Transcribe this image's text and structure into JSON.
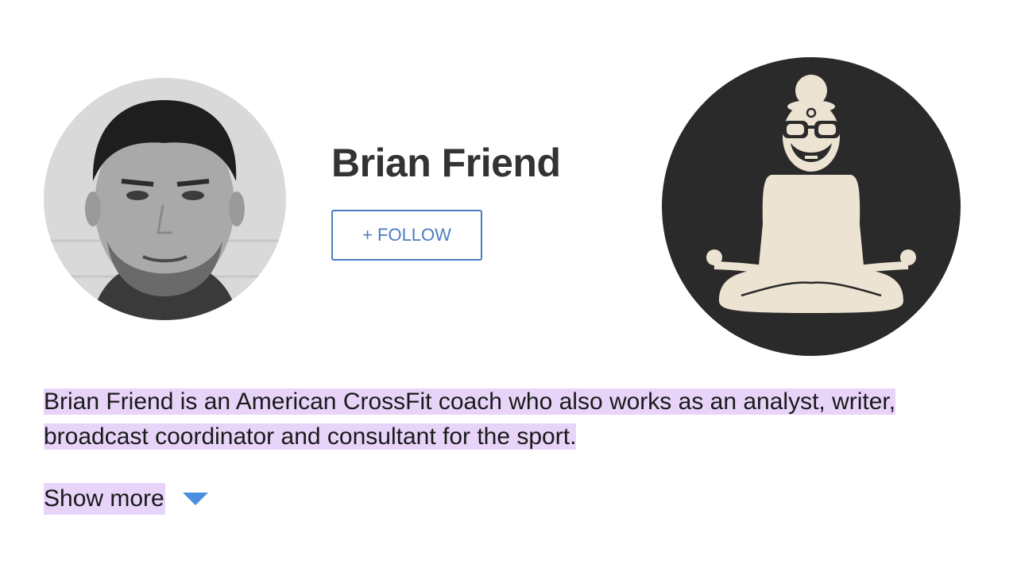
{
  "profile": {
    "name": "Brian Friend",
    "follow_label": "+ FOLLOW",
    "description": "Brian Friend is an American CrossFit coach who also works as an analyst, writer, broadcast coordinator and consultant for the sport.",
    "show_more_label": "Show more"
  },
  "colors": {
    "name_text": "#333333",
    "follow_accent": "#4a7dbd",
    "highlight": "#e7d4f8",
    "caret": "#4a8ee0",
    "logo_background": "#2a2a2a",
    "logo_figure": "#ede3d3"
  },
  "icons": {
    "avatar": "person-photo-avatar",
    "logo": "meditating-figure-logo",
    "caret": "chevron-down-icon"
  }
}
